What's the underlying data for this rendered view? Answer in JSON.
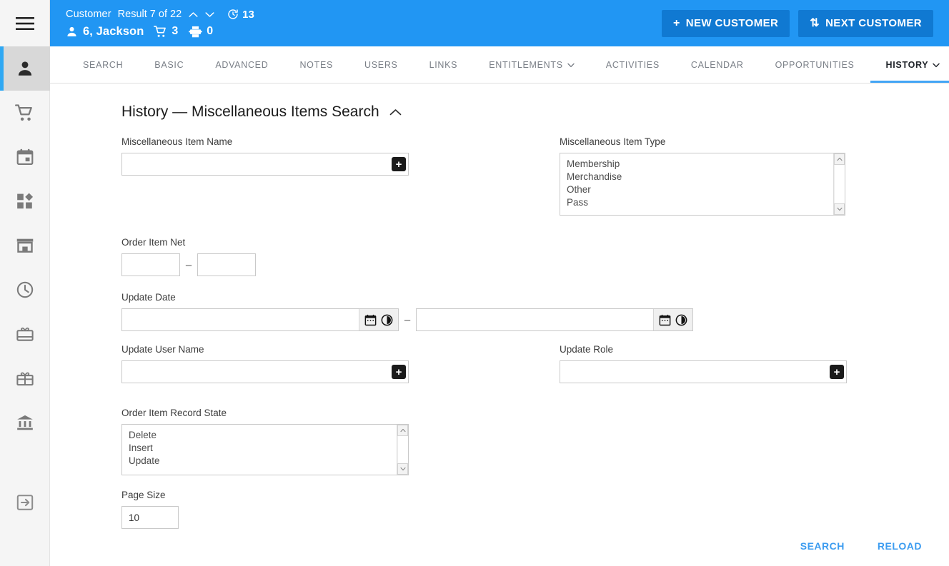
{
  "colors": {
    "header_blue": "#2196f3",
    "header_button_blue": "#1079d2",
    "accent_underline": "#42a5f5",
    "link_blue": "#3c9cf0",
    "rail_bg": "#f5f5f5",
    "rail_active_bg": "#d8d8d8",
    "rail_active_marker": "#2fa8f3"
  },
  "sidebar": {
    "menu_icon": "hamburger-menu-icon",
    "items": [
      {
        "name": "person-icon",
        "label": "Customer",
        "active": true
      },
      {
        "name": "shopping-cart-icon",
        "label": "Orders",
        "active": false
      },
      {
        "name": "calendar-icon",
        "label": "Calendar",
        "active": false
      },
      {
        "name": "apps-grid-icon",
        "label": "Products",
        "active": false
      },
      {
        "name": "store-icon",
        "label": "Store",
        "active": false
      },
      {
        "name": "clock-icon",
        "label": "History",
        "active": false
      },
      {
        "name": "gift-card-icon",
        "label": "Gift Cards",
        "active": false
      },
      {
        "name": "gift-box-icon",
        "label": "Gifts",
        "active": false
      },
      {
        "name": "bank-icon",
        "label": "Accounting",
        "active": false
      }
    ],
    "logout": {
      "name": "logout-icon",
      "label": "Logout"
    }
  },
  "header": {
    "entity_label": "Customer",
    "result_text": "Result 7 of 22",
    "prev_icon": "chevron-up-icon",
    "next_icon": "chevron-down-icon",
    "history_icon": "history-clock-icon",
    "history_count": "13",
    "customer_icon": "person-icon",
    "customer_name": "6, Jackson",
    "cart_icon": "shopping-cart-icon",
    "cart_count": "3",
    "print_icon": "printer-icon",
    "print_count": "0",
    "new_customer_button": "NEW CUSTOMER",
    "new_customer_glyph": "+",
    "next_customer_button": "NEXT CUSTOMER",
    "next_customer_glyph": "⇅"
  },
  "tabs": [
    {
      "label": "SEARCH",
      "active": false,
      "dropdown": false
    },
    {
      "label": "BASIC",
      "active": false,
      "dropdown": false
    },
    {
      "label": "ADVANCED",
      "active": false,
      "dropdown": false
    },
    {
      "label": "NOTES",
      "active": false,
      "dropdown": false
    },
    {
      "label": "USERS",
      "active": false,
      "dropdown": false
    },
    {
      "label": "LINKS",
      "active": false,
      "dropdown": false
    },
    {
      "label": "ENTITLEMENTS",
      "active": false,
      "dropdown": true
    },
    {
      "label": "ACTIVITIES",
      "active": false,
      "dropdown": false
    },
    {
      "label": "CALENDAR",
      "active": false,
      "dropdown": false
    },
    {
      "label": "OPPORTUNITIES",
      "active": false,
      "dropdown": false
    },
    {
      "label": "HISTORY",
      "active": true,
      "dropdown": true
    }
  ],
  "page": {
    "title": "History — Miscellaneous Items Search",
    "collapse_icon": "chevron-up-icon"
  },
  "form": {
    "misc_item_name": {
      "label": "Miscellaneous Item Name",
      "value": "",
      "placeholder": "",
      "lookup_glyph": "+"
    },
    "misc_item_type": {
      "label": "Miscellaneous Item Type",
      "options": [
        "Membership",
        "Merchandise",
        "Other",
        "Pass"
      ],
      "selected": "",
      "scroll_up_glyph": "⌃",
      "scroll_down_glyph": "⌄"
    },
    "order_item_net": {
      "label": "Order Item Net",
      "from_value": "",
      "to_value": "",
      "separator": "–"
    },
    "update_date": {
      "label": "Update Date",
      "from_value": "",
      "to_value": "",
      "separator": "–",
      "calendar_icon": "calendar-icon",
      "clock_icon": "clock-icon"
    },
    "update_user_name": {
      "label": "Update User Name",
      "value": "",
      "lookup_glyph": "+"
    },
    "update_role": {
      "label": "Update Role",
      "value": "",
      "lookup_glyph": "+"
    },
    "order_item_record_state": {
      "label": "Order Item Record State",
      "options": [
        "Delete",
        "Insert",
        "Update"
      ],
      "selected": "",
      "scroll_up_glyph": "⌃",
      "scroll_down_glyph": "⌄"
    },
    "page_size": {
      "label": "Page Size",
      "value": "10"
    }
  },
  "actions": {
    "search_label": "SEARCH",
    "reload_label": "RELOAD"
  }
}
